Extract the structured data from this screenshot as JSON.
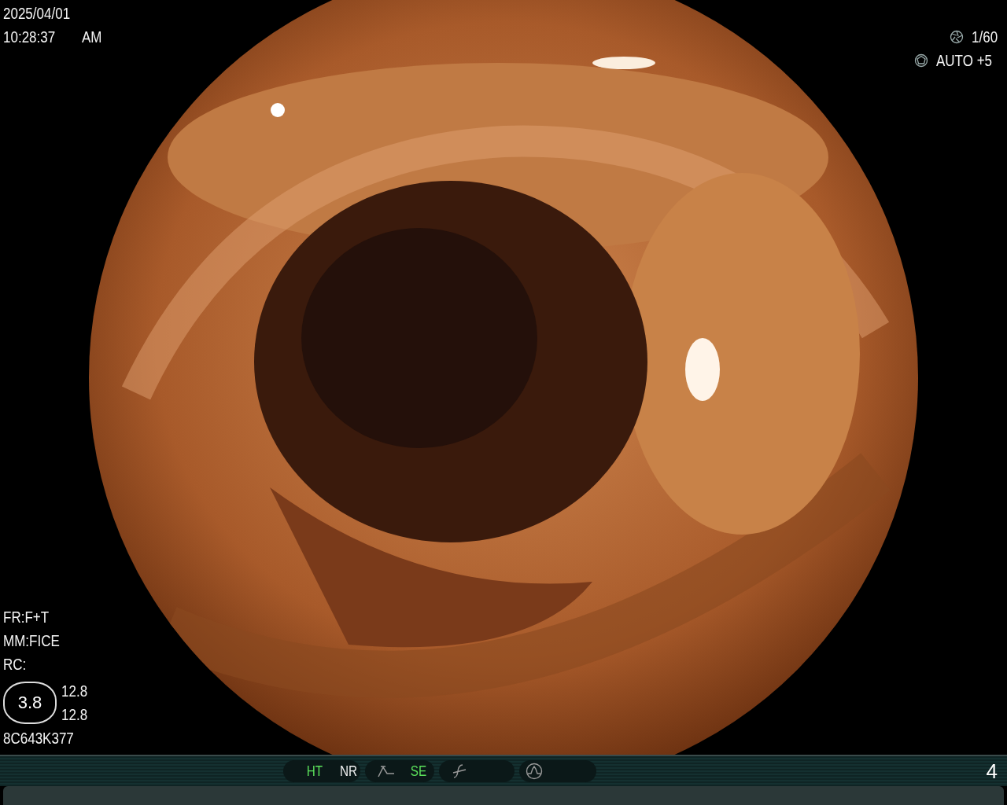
{
  "date": "2025/04/01",
  "time": "10:28:37",
  "meridiem": "AM",
  "exposure": [
    {
      "kind": "shutter",
      "value": "1/60"
    },
    {
      "kind": "iris",
      "value": "AUTO +5"
    }
  ],
  "settings": [
    "FR:F+T",
    "MM:FICE",
    "RC:"
  ],
  "zoom": {
    "value": "3.8",
    "readings": [
      "12.8",
      "12.8"
    ]
  },
  "serial": "8C643K377",
  "status_bar": {
    "groups": [
      {
        "kind": "plain",
        "items": [
          {
            "label": "HT",
            "active": true
          },
          {
            "label": "NR",
            "active": false
          }
        ]
      },
      {
        "kind": "curve",
        "items": [
          {
            "label": "SE",
            "active": true
          }
        ]
      },
      {
        "kind": "slash"
      },
      {
        "kind": "wave"
      }
    ],
    "page": "4"
  }
}
